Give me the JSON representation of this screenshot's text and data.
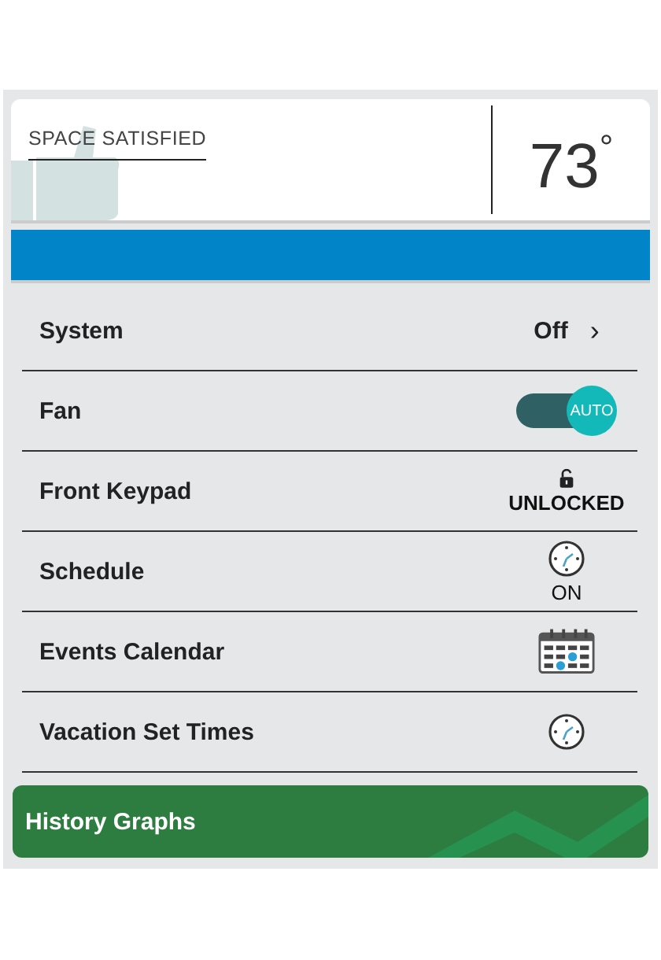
{
  "status": {
    "label": "SPACE SATISFIED",
    "temperature": "73",
    "unit": "°"
  },
  "rows": [
    {
      "label": "System",
      "kind": "value",
      "value": "Off",
      "chevron": "›"
    },
    {
      "label": "Fan",
      "kind": "toggle",
      "on": true,
      "toggle_label": "AUTO"
    },
    {
      "label": "Front Keypad",
      "kind": "lock",
      "value": "UNLOCKED"
    },
    {
      "label": "Schedule",
      "kind": "clock",
      "value": "ON"
    },
    {
      "label": "Events Calendar",
      "kind": "calendar"
    },
    {
      "label": "Vacation Set Times",
      "kind": "clock"
    }
  ],
  "history_button": {
    "label": "History Graphs"
  }
}
